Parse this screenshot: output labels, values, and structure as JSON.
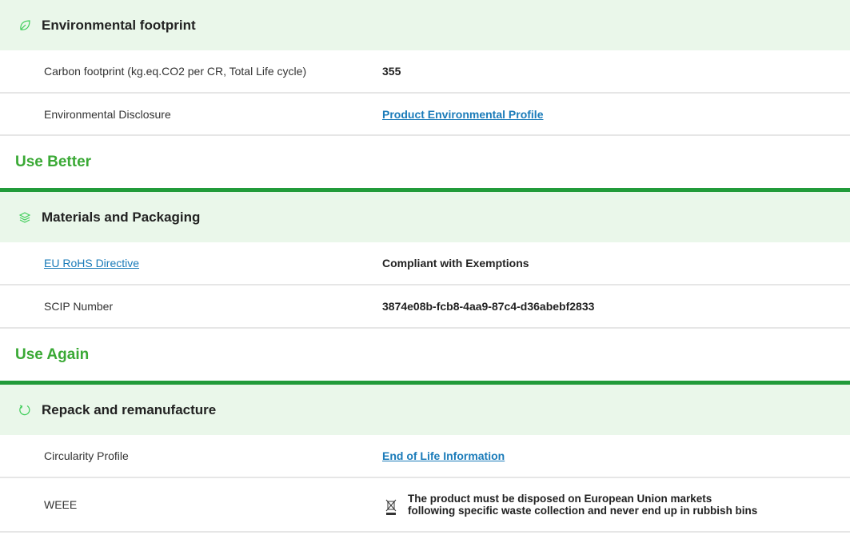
{
  "environmental_footprint": {
    "title": "Environmental footprint",
    "icon": "leaf-icon",
    "rows": [
      {
        "label": "Carbon footprint (kg.eq.CO2 per CR, Total Life cycle)",
        "value": "355"
      },
      {
        "label": "Environmental Disclosure",
        "value": "Product Environmental Profile"
      }
    ]
  },
  "use_better": {
    "title": "Use Better",
    "block": {
      "title": "Materials and Packaging",
      "icon": "layers-icon",
      "rows": [
        {
          "label": "EU RoHS Directive",
          "value": "Compliant with Exemptions"
        },
        {
          "label": "SCIP Number",
          "value": "3874e08b-fcb8-4aa9-87c4-d36abebf2833"
        }
      ]
    }
  },
  "use_again": {
    "title": "Use Again",
    "block": {
      "title": "Repack and remanufacture",
      "icon": "cycle-icon",
      "rows": [
        {
          "label": "Circularity Profile",
          "value": "End of Life Information"
        },
        {
          "label": "WEEE",
          "value": "The product must be disposed on European Union markets following specific waste collection and never end up in rubbish bins"
        }
      ]
    }
  },
  "colors": {
    "accent_green": "#3aa935",
    "section_rule": "#219b3a",
    "header_bg": "#eaf7ea",
    "link": "#1a7bb9"
  }
}
